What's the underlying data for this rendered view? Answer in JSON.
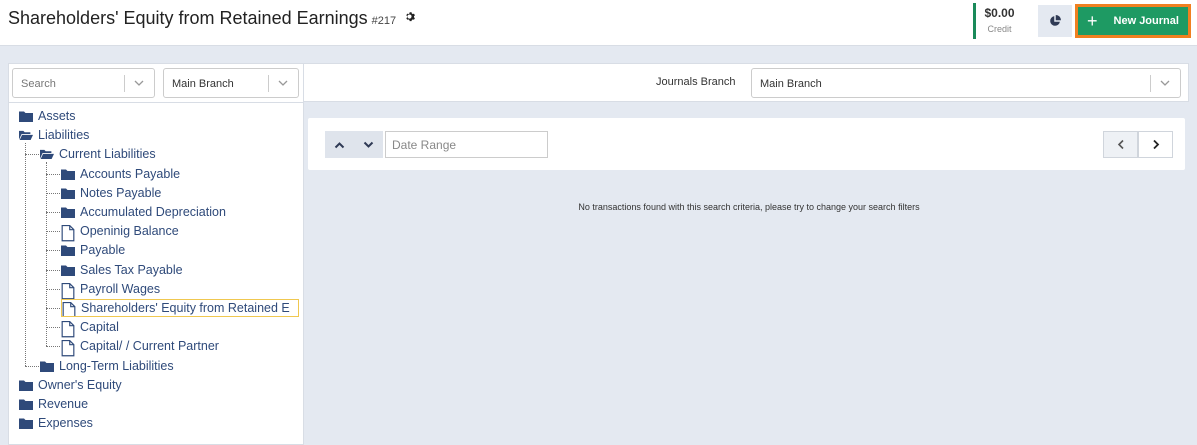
{
  "header": {
    "title": "Shareholders' Equity from Retained Earnings",
    "number": "#217",
    "gear_icon": "gear-icon",
    "credit_amount": "$0.00",
    "credit_label": "Credit",
    "new_journal_label": "New Journal"
  },
  "filters": {
    "search_placeholder": "Search",
    "branch_value": "Main Branch"
  },
  "tree": [
    {
      "label": "Assets",
      "type": "folder"
    },
    {
      "label": "Liabilities",
      "type": "folder-open"
    },
    {
      "label": "Current Liabilities",
      "type": "folder-open"
    },
    {
      "label": "Accounts Payable",
      "type": "folder"
    },
    {
      "label": "Notes Payable",
      "type": "folder"
    },
    {
      "label": "Accumulated Depreciation",
      "type": "folder"
    },
    {
      "label": "Openinig Balance",
      "type": "file"
    },
    {
      "label": "Payable",
      "type": "folder"
    },
    {
      "label": "Sales Tax Payable",
      "type": "folder"
    },
    {
      "label": "Payroll Wages",
      "type": "file"
    },
    {
      "label": "Shareholders' Equity from Retained E",
      "type": "file"
    },
    {
      "label": "Capital",
      "type": "file"
    },
    {
      "label": "Capital/ / Current Partner",
      "type": "file"
    },
    {
      "label": "Long-Term Liabilities",
      "type": "folder"
    },
    {
      "label": "Owner's Equity",
      "type": "folder"
    },
    {
      "label": "Revenue",
      "type": "folder"
    },
    {
      "label": "Expenses",
      "type": "folder"
    }
  ],
  "journals_branch": {
    "label": "Journals Branch",
    "value": "Main Branch"
  },
  "toolbar": {
    "date_range_placeholder": "Date Range"
  },
  "empty_message": "No transactions found with this search criteria, please try to change your search filters",
  "colors": {
    "accent_green": "#1e9a63",
    "highlight_orange": "#f08020",
    "tree_text": "#2f4a7a"
  }
}
